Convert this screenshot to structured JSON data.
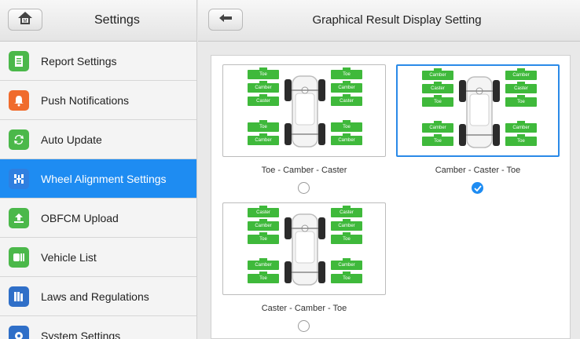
{
  "sidebar": {
    "title": "Settings",
    "items": [
      {
        "label": "Report Settings",
        "icon": "report-icon",
        "color": "#4bb84a"
      },
      {
        "label": "Push Notifications",
        "icon": "bell-icon",
        "color": "#f06b2c"
      },
      {
        "label": "Auto Update",
        "icon": "refresh-icon",
        "color": "#4bb84a"
      },
      {
        "label": "Wheel Alignment Settings",
        "icon": "wheel-alignment-icon",
        "color": "#2f7fe0",
        "active": true
      },
      {
        "label": "OBFCM Upload",
        "icon": "upload-icon",
        "color": "#4bb84a"
      },
      {
        "label": "Vehicle List",
        "icon": "vehicle-list-icon",
        "color": "#4bb84a"
      },
      {
        "label": "Laws and Regulations",
        "icon": "laws-icon",
        "color": "#2f6fc8"
      },
      {
        "label": "System Settings",
        "icon": "gear-icon",
        "color": "#2f6fc8"
      }
    ]
  },
  "header": {
    "title": "Graphical Result Display Setting"
  },
  "options": [
    {
      "label": "Toe - Camber - Caster",
      "selected": false,
      "front_left": [
        "Toe",
        "Camber",
        "Caster"
      ],
      "front_right": [
        "Toe",
        "Camber",
        "Caster"
      ],
      "rear_left": [
        "Toe",
        "Camber"
      ],
      "rear_right": [
        "Toe",
        "Camber"
      ]
    },
    {
      "label": "Camber - Caster - Toe",
      "selected": true,
      "front_left": [
        "Camber",
        "Caster",
        "Toe"
      ],
      "front_right": [
        "Camber",
        "Caster",
        "Toe"
      ],
      "rear_left": [
        "Camber",
        "Toe"
      ],
      "rear_right": [
        "Camber",
        "Toe"
      ]
    },
    {
      "label": "Caster - Camber - Toe",
      "selected": false,
      "front_left": [
        "Caster",
        "Camber",
        "Toe"
      ],
      "front_right": [
        "Caster",
        "Camber",
        "Toe"
      ],
      "rear_left": [
        "Camber",
        "Toe"
      ],
      "rear_right": [
        "Camber",
        "Toe"
      ]
    }
  ],
  "colors": {
    "accent": "#1e8cf2",
    "tag_green": "#3fb93b"
  }
}
